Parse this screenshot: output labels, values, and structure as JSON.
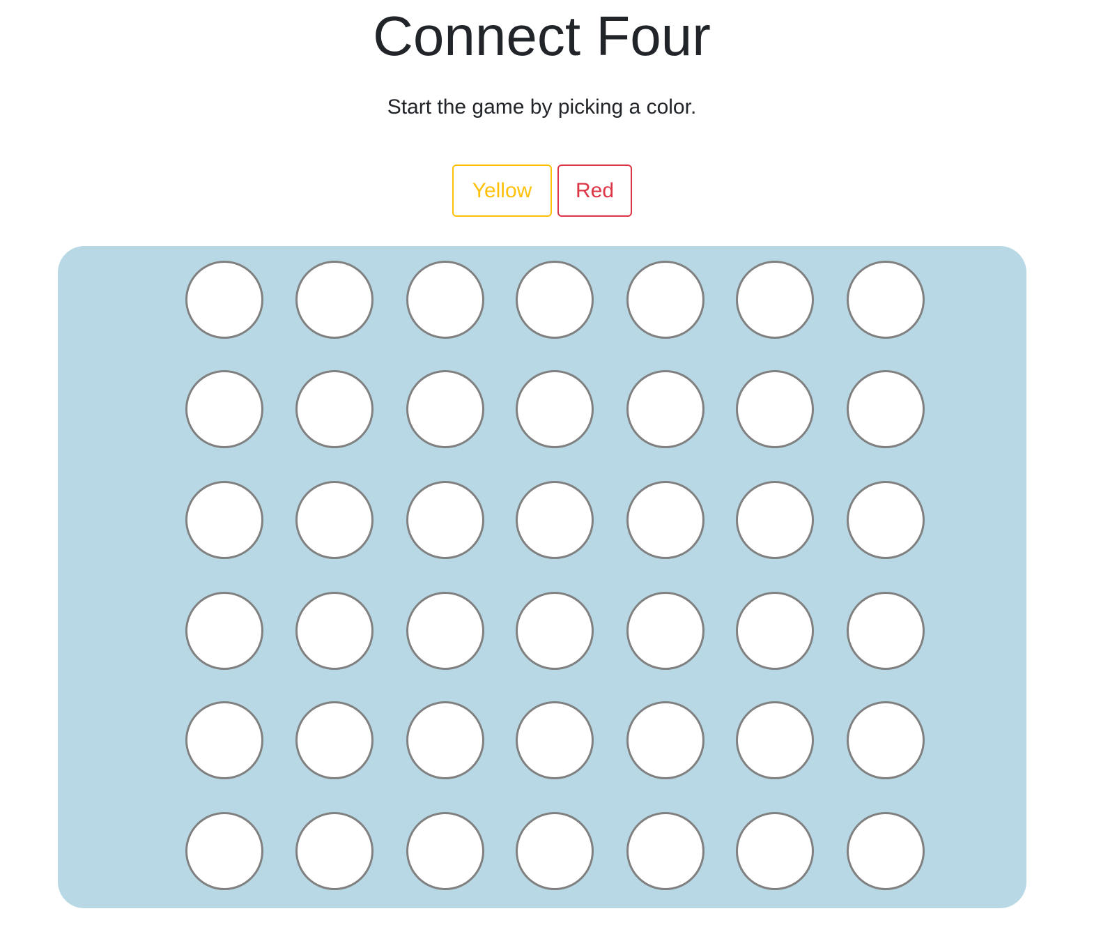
{
  "header": {
    "title": "Connect Four",
    "subtitle": "Start the game by picking a color."
  },
  "color_picker": {
    "options": [
      {
        "label": "Yellow",
        "color": "#ffc107"
      },
      {
        "label": "Red",
        "color": "#dc3545"
      }
    ]
  },
  "board": {
    "rows": 6,
    "columns": 7,
    "background_color": "#b7d8e4",
    "cell_color": "#ffffff",
    "cell_border_color": "#808080",
    "cells": [
      [
        "empty",
        "empty",
        "empty",
        "empty",
        "empty",
        "empty",
        "empty"
      ],
      [
        "empty",
        "empty",
        "empty",
        "empty",
        "empty",
        "empty",
        "empty"
      ],
      [
        "empty",
        "empty",
        "empty",
        "empty",
        "empty",
        "empty",
        "empty"
      ],
      [
        "empty",
        "empty",
        "empty",
        "empty",
        "empty",
        "empty",
        "empty"
      ],
      [
        "empty",
        "empty",
        "empty",
        "empty",
        "empty",
        "empty",
        "empty"
      ],
      [
        "empty",
        "empty",
        "empty",
        "empty",
        "empty",
        "empty",
        "empty"
      ]
    ]
  }
}
